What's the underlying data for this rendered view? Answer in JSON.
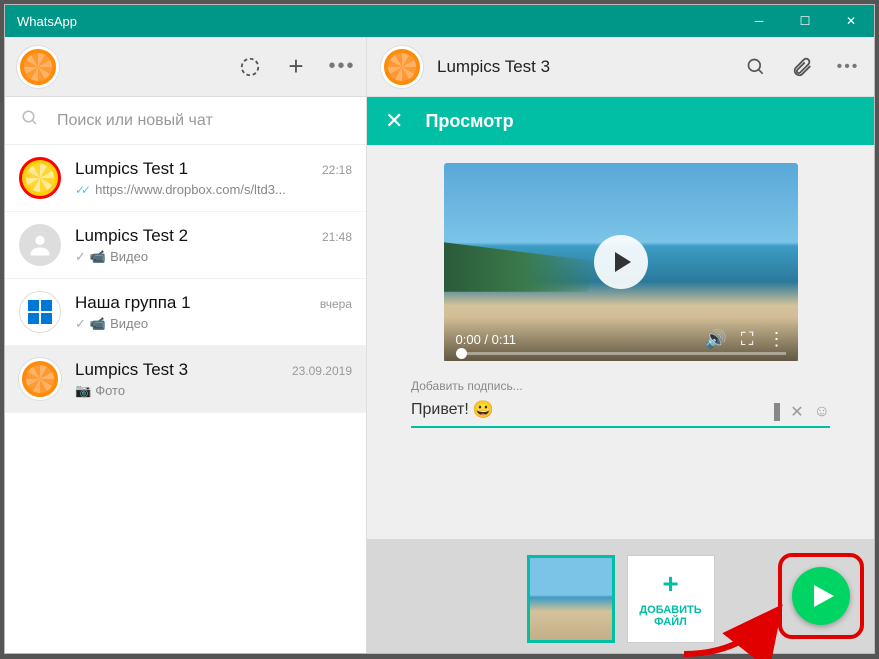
{
  "app_title": "WhatsApp",
  "search_placeholder": "Поиск или новый чат",
  "chats": [
    {
      "name": "Lumpics Test 1",
      "time": "22:18",
      "preview": "https://www.dropbox.com/s/ltd3..."
    },
    {
      "name": "Lumpics Test 2",
      "time": "21:48",
      "preview": "Видео"
    },
    {
      "name": "Наша группа 1",
      "time": "вчера",
      "preview": "Видео"
    },
    {
      "name": "Lumpics Test 3",
      "time": "23.09.2019",
      "preview": "Фото"
    }
  ],
  "current_chat": "Lumpics Test 3",
  "preview_title": "Просмотр",
  "video": {
    "current_time": "0:00",
    "duration": "0:11"
  },
  "caption_label": "Добавить подпись...",
  "caption_value": "Привет!",
  "add_file_label": "ДОБАВИТЬ ФАЙЛ"
}
